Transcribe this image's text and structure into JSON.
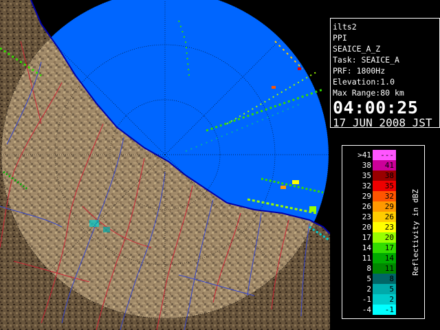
{
  "info": {
    "station": "ilts2",
    "product": "PPI",
    "product_name": "SEAICE_A_Z",
    "task": "Task: SEAICE_A",
    "prf": "PRF: 1800Hz",
    "elevation": "Elevation:1.0",
    "max_range": "Max Range:80 km",
    "time": "04:00:25",
    "date": "17 JUN 2008 JST"
  },
  "legend": {
    "title": "Reflectivity in dBZ",
    "rows": [
      {
        "left": ">41",
        "right": "---",
        "color": "#ff55ff"
      },
      {
        "left": "38",
        "right": "41",
        "color": "#cc0099"
      },
      {
        "left": "35",
        "right": "38",
        "color": "#990000"
      },
      {
        "left": "32",
        "right": "35",
        "color": "#ee0000"
      },
      {
        "left": "29",
        "right": "32",
        "color": "#ff5500"
      },
      {
        "left": "26",
        "right": "29",
        "color": "#ff9900"
      },
      {
        "left": "23",
        "right": "26",
        "color": "#ffcc00"
      },
      {
        "left": "20",
        "right": "23",
        "color": "#ffff00"
      },
      {
        "left": "17",
        "right": "20",
        "color": "#99ff00"
      },
      {
        "left": "14",
        "right": "17",
        "color": "#33dd00"
      },
      {
        "left": "11",
        "right": "14",
        "color": "#00aa00"
      },
      {
        "left": "8",
        "right": "11",
        "color": "#008800"
      },
      {
        "left": "5",
        "right": "8",
        "color": "#006666"
      },
      {
        "left": "2",
        "right": "5",
        "color": "#00aaaa"
      },
      {
        "left": "-1",
        "right": "2",
        "color": "#00cccc"
      },
      {
        "left": "-4",
        "right": "-1",
        "color": "#00ffff"
      }
    ]
  },
  "colors": {
    "sea": "#0066ff",
    "land": "#8a7152",
    "land_dark": "#5a4430",
    "coast": "#0000aa",
    "range_rings": "#001133",
    "rivers_red": "#cc2233",
    "rivers_blue": "#3344cc"
  }
}
